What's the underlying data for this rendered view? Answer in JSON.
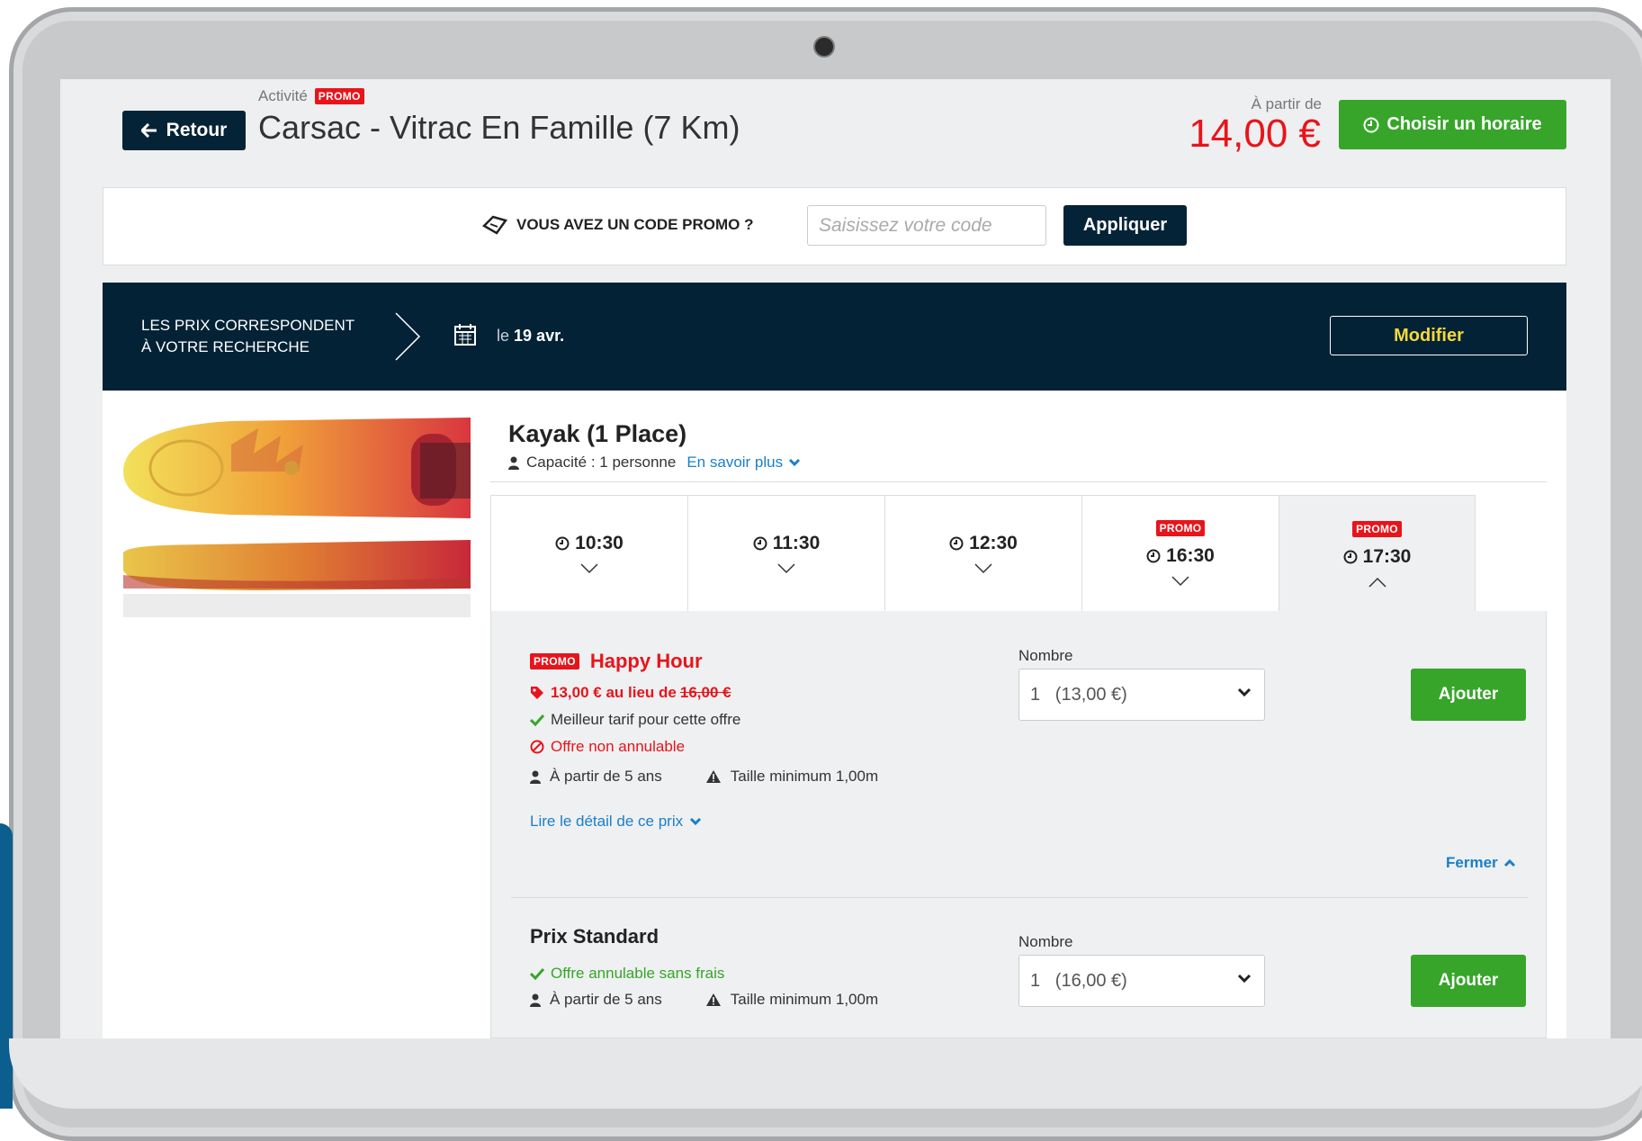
{
  "header": {
    "back_label": "Retour",
    "activity_label": "Activité",
    "promo_tag": "PROMO",
    "title": "Carsac - Vitrac En Famille (7 Km)",
    "from_label": "À partir de",
    "price": "14,00 €",
    "choose_label": "Choisir un horaire"
  },
  "promo_code": {
    "question": "VOUS AVEZ UN CODE PROMO ?",
    "placeholder": "Saisissez votre code",
    "apply_label": "Appliquer"
  },
  "search_bar": {
    "line1": "LES PRIX CORRESPONDENT",
    "line2": "À VOTRE RECHERCHE",
    "date_prefix": "le",
    "date": "19 avr.",
    "modify_label": "Modifier"
  },
  "product": {
    "title": "Kayak (1 Place)",
    "capacity": "Capacité : 1 personne",
    "more_link": "En savoir plus"
  },
  "time_slots": [
    {
      "time": "10:30",
      "promo": false,
      "active": false
    },
    {
      "time": "11:30",
      "promo": false,
      "active": false
    },
    {
      "time": "12:30",
      "promo": false,
      "active": false
    },
    {
      "time": "16:30",
      "promo": true,
      "active": false
    },
    {
      "time": "17:30",
      "promo": true,
      "active": true
    }
  ],
  "offers": [
    {
      "promo_tag": "PROMO",
      "name": "Happy Hour",
      "price_text": "13,00 € au lieu de",
      "old_price": "16,00 €",
      "best_rate": "Meilleur tarif pour cette offre",
      "non_cancellable": "Offre non annulable",
      "age": "À partir de 5 ans",
      "min_height": "Taille minimum 1,00m",
      "details_link": "Lire le détail de ce prix",
      "nombre_label": "Nombre",
      "select_value": "1   (13,00 €)",
      "add_label": "Ajouter",
      "close_label": "Fermer"
    },
    {
      "name": "Prix Standard",
      "cancellable": "Offre annulable sans frais",
      "age": "À partir de 5 ans",
      "min_height": "Taille minimum 1,00m",
      "nombre_label": "Nombre",
      "select_value": "1   (16,00 €)",
      "add_label": "Ajouter"
    }
  ],
  "colors": {
    "navy": "#042236",
    "green": "#37a52a",
    "red": "#e8141b",
    "link_blue": "#1a7fc8",
    "modify_yellow": "#f5d93b"
  },
  "icons": [
    "arrow-left-icon",
    "clock-icon",
    "ticket-icon",
    "chevron-right-icon",
    "calendar-icon",
    "user-icon",
    "chevron-down-icon",
    "chevron-up-icon",
    "tag-icon",
    "check-icon",
    "ban-icon",
    "warning-icon"
  ]
}
